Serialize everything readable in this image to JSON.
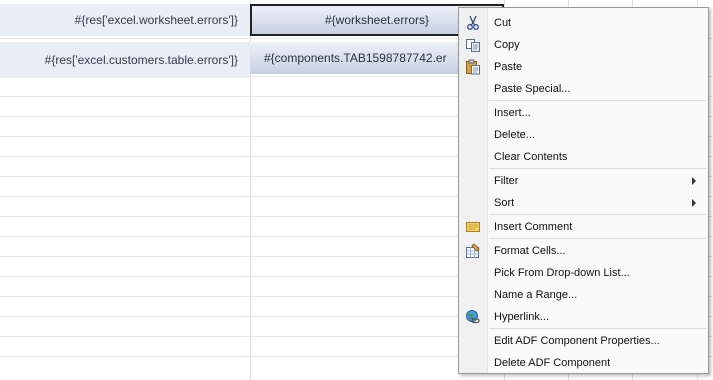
{
  "sheet": {
    "rows": [
      {
        "label": "#{res['excel.worksheet.errors']}",
        "value": "#{worksheet.errors}"
      },
      {
        "label": "#{res['excel.customers.table.errors']}",
        "value": "#{components.TAB1598787742.er"
      }
    ]
  },
  "context_menu": {
    "items": [
      {
        "label": "Cut",
        "icon": "scissors-icon"
      },
      {
        "label": "Copy",
        "icon": "copy-icon"
      },
      {
        "label": "Paste",
        "icon": "paste-icon"
      },
      {
        "label": "Paste Special..."
      },
      {
        "label": "Insert..."
      },
      {
        "label": "Delete..."
      },
      {
        "label": "Clear Contents"
      },
      {
        "label": "Filter",
        "submenu": true
      },
      {
        "label": "Sort",
        "submenu": true
      },
      {
        "label": "Insert Comment",
        "icon": "comment-icon"
      },
      {
        "label": "Format Cells...",
        "icon": "format-cells-icon"
      },
      {
        "label": "Pick From Drop-down List..."
      },
      {
        "label": "Name a Range..."
      },
      {
        "label": "Hyperlink...",
        "icon": "hyperlink-icon"
      },
      {
        "label": "Edit ADF Component Properties..."
      },
      {
        "label": "Delete ADF Component"
      }
    ]
  }
}
